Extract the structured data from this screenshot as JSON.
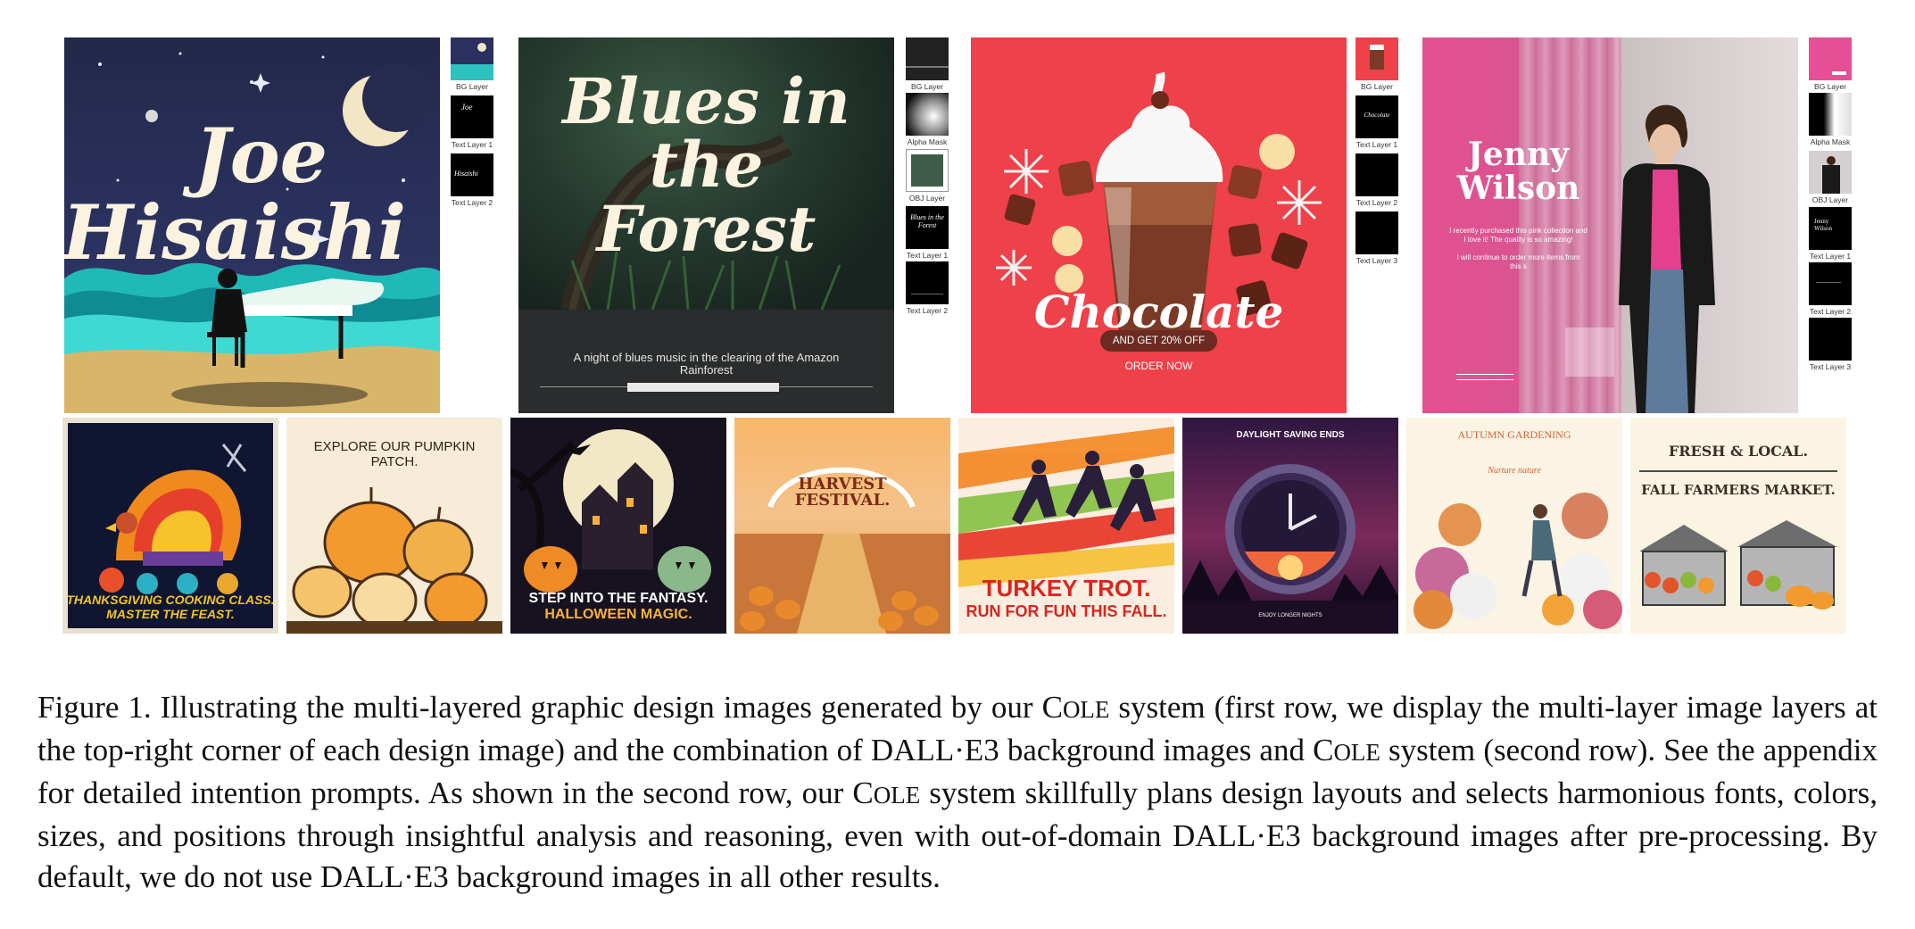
{
  "row1": {
    "designs": [
      {
        "title_line1": "Joe",
        "title_line2": "Hisaishi",
        "layers": [
          "BG Layer",
          "Text Layer 1",
          "Text Layer 2"
        ],
        "thumb_texts": [
          "Joe",
          "Hisaishi"
        ]
      },
      {
        "title_line1": "Blues in the",
        "title_line2": "Forest",
        "subtitle_line1": "A night of blues music in the clearing of the Amazon",
        "subtitle_line2": "Rainforest",
        "layers": [
          "BG Layer",
          "Alpha Mask",
          "OBJ Layer",
          "Text Layer 1",
          "Text Layer 2"
        ],
        "thumb_text": "Blues in the Forest"
      },
      {
        "title": "Chocolate",
        "offer": "AND GET 20% OFF",
        "cta": "ORDER NOW",
        "layers": [
          "BG Layer",
          "Text Layer 1",
          "Text Layer 2",
          "Text Layer 3"
        ],
        "thumb_text": "Chocolate"
      },
      {
        "title_line1": "Jenny",
        "title_line2": "Wilson",
        "body_line1": "I recently purchased this pink collection and",
        "body_line2": "I love it! The quality is so amazing!",
        "body_line3": "I will continue to order more items from",
        "body_line4": "this s",
        "layers": [
          "BG Layer",
          "Alpha Mask",
          "OBJ Layer",
          "Text Layer 1",
          "Text Layer 2",
          "Text Layer 3"
        ],
        "thumb_text": "Jenny Wilson"
      }
    ]
  },
  "row2": {
    "tiles": [
      {
        "line1": "THANKSGIVING COOKING CLASS.",
        "line2": "MASTER THE FEAST."
      },
      {
        "line1": "EXPLORE OUR PUMPKIN",
        "line2": "PATCH."
      },
      {
        "line1": "STEP INTO THE FANTASY.",
        "line2": "HALLOWEEN MAGIC."
      },
      {
        "line1": "HARVEST",
        "line2": "FESTIVAL."
      },
      {
        "line1": "TURKEY TROT.",
        "line2": "RUN FOR FUN THIS FALL."
      },
      {
        "line1": "DAYLIGHT SAVING ENDS",
        "line2": "ENJOY LONGER NIGHTS"
      },
      {
        "line1": "AUTUMN GARDENING",
        "line2": "Nurture nature"
      },
      {
        "line1": "FRESH & LOCAL.",
        "line2": "FALL FARMERS MARKET."
      }
    ]
  },
  "caption": {
    "label": "Figure 1.",
    "s1": "Illustrating the multi-layered graphic design images generated by our",
    "cole_C": "C",
    "cole_rest": "OLE",
    "s2": "system (first row, we display the multi-layer image layers at the top-right corner of each design image) and the combination of DALL·E3 background images and",
    "s3": "system (second row). See the appendix for detailed intention prompts. As shown in the second row, our",
    "s4": "system skillfully plans design layouts and selects harmonious fonts, colors, sizes, and positions through insightful analysis and reasoning, even with out-of-domain DALL·E3 background images after pre-processing. By default, we do not use DALL·E3 background images in all other results."
  },
  "colors": {
    "night_sky": "#262b4f",
    "forest": "#1c2a22",
    "chocolate_bg": "#ee4149",
    "pink": "#e64f95"
  }
}
